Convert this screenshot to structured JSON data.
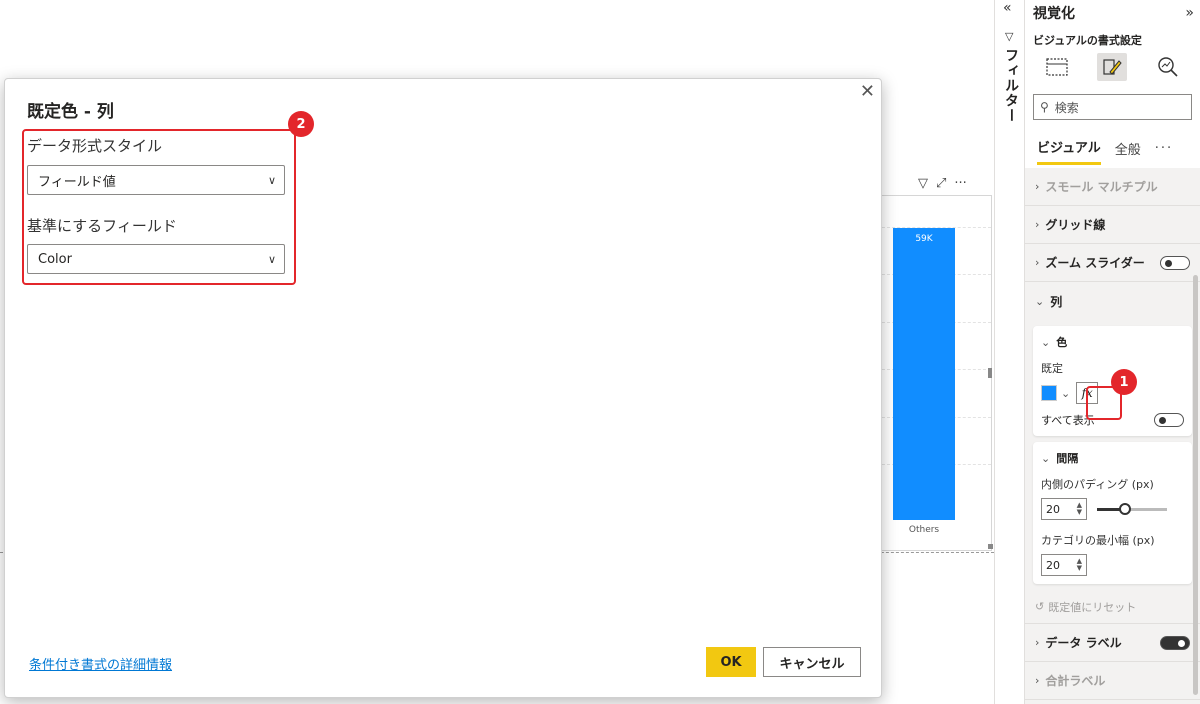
{
  "visual": {
    "bar_value_label": "59K",
    "category_label": "Others",
    "bar_color": "#118dff"
  },
  "filters_pane": {
    "label": "フィルター",
    "collapse_icon": "double-chevron-left-icon"
  },
  "viz_pane": {
    "title": "視覚化",
    "subtitle": "ビジュアルの書式設定",
    "search_placeholder": "検索",
    "tabs": [
      {
        "label": "ビジュアル",
        "active": true
      },
      {
        "label": "全般",
        "active": false
      },
      {
        "label": "···",
        "active": false
      }
    ],
    "sections": {
      "small_multiples": "スモール マルチプル",
      "gridlines": "グリッド線",
      "zoom_slider": "ズーム スライダー",
      "columns": "列",
      "data_labels": "データ ラベル",
      "total_labels": "合計ラベル"
    },
    "color_card": {
      "title": "色",
      "default_label": "既定",
      "fx_label": "fx",
      "show_all_label": "すべて表示",
      "swatch_color": "#118dff"
    },
    "spacing_card": {
      "title": "間隔",
      "inner_padding_label": "内側のパディング (px)",
      "inner_padding_value": "20",
      "inner_padding_slider_fraction": 0.4,
      "category_min_width_label": "カテゴリの最小幅 (px)",
      "category_min_width_value": "20"
    },
    "reset_label": "既定値にリセット"
  },
  "dialog": {
    "title": "既定色 - 列",
    "format_style_label": "データ形式スタイル",
    "format_style_value": "フィールド値",
    "based_on_label": "基準にするフィールド",
    "based_on_value": "Color",
    "learn_more_link": "条件付き書式の詳細情報",
    "ok_label": "OK",
    "cancel_label": "キャンセル"
  },
  "annotations": {
    "badge_1": "1",
    "badge_2": "2",
    "color": "#e3262b"
  }
}
